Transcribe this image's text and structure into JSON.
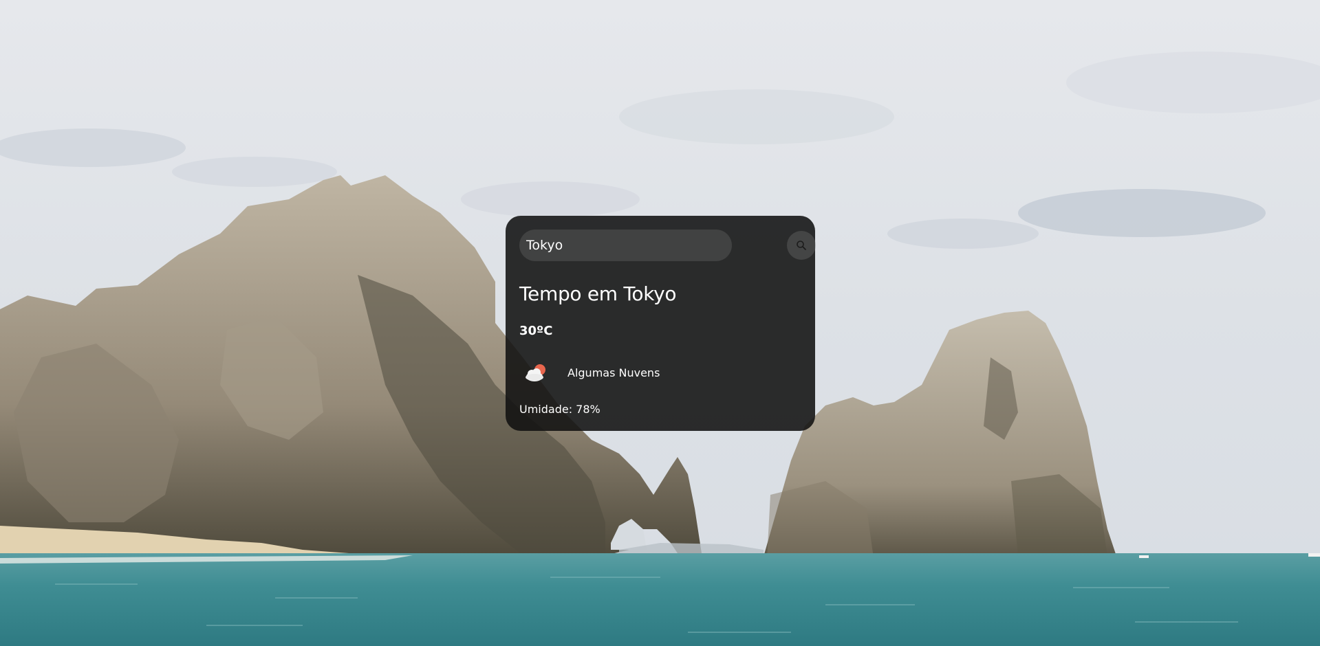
{
  "search": {
    "value": "Tokyo",
    "button_icon": "search-icon"
  },
  "weather": {
    "title": "Tempo em Tokyo",
    "temperature": "30ºC",
    "icon": "partly-cloudy-icon",
    "description": "Algumas Nuvens",
    "humidity": "Umidade: 78%"
  },
  "background": {
    "icon": "landscape-photo",
    "sky_color": "#dfe2e7",
    "rock_color": "#9a8f7e",
    "sea_color": "#3e8b90",
    "sand_color": "#e3d3b1"
  },
  "theme": {
    "card_color": "#111111",
    "text_color": "#ffffff",
    "sun_color": "#e8664e"
  }
}
